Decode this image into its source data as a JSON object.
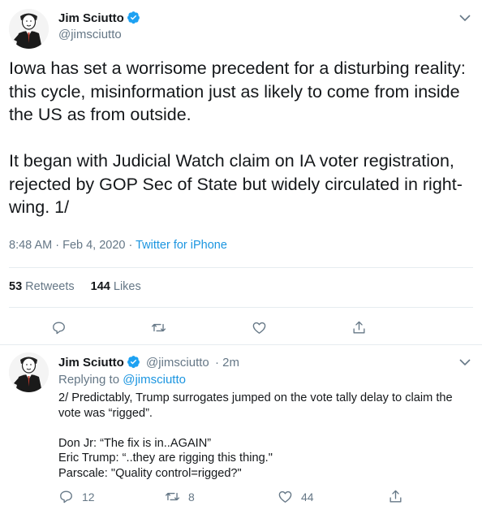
{
  "main_tweet": {
    "name": "Jim Sciutto",
    "handle": "@jimsciutto",
    "text": "Iowa has set a worrisome precedent for a disturbing reality: this cycle, misinformation just as likely to come from inside the US as from outside.\n\nIt began with Judicial Watch claim on IA voter registration, rejected by GOP Sec of State but widely circulated in right-wing. 1/",
    "time": "8:48 AM · Feb 4, 2020",
    "separator": " · ",
    "source": "Twitter for iPhone",
    "retweets_count": "53",
    "retweets_label": "Retweets",
    "likes_count": "144",
    "likes_label": "Likes"
  },
  "reply_tweet": {
    "name": "Jim Sciutto",
    "handle": "@jimsciutto",
    "age": "· 2m",
    "replying_prefix": "Replying to",
    "replying_to": "@jimsciutto",
    "text": "2/ Predictably, Trump surrogates jumped on the vote tally delay to claim the vote was “rigged”.\n\nDon Jr: “The fix is in..AGAIN”\nEric Trump: “..they are rigging this thing.\"\nParscale: \"Quality control=rigged?\"",
    "reply_count": "12",
    "retweet_count": "8",
    "like_count": "44"
  },
  "colors": {
    "verified": "#1da1f2",
    "link": "#1b95e0",
    "secondary": "#657786",
    "border": "#e6ecf0"
  },
  "icons": [
    "verified-badge-icon",
    "chevron-down-icon",
    "reply-icon",
    "retweet-icon",
    "like-icon",
    "share-icon"
  ]
}
